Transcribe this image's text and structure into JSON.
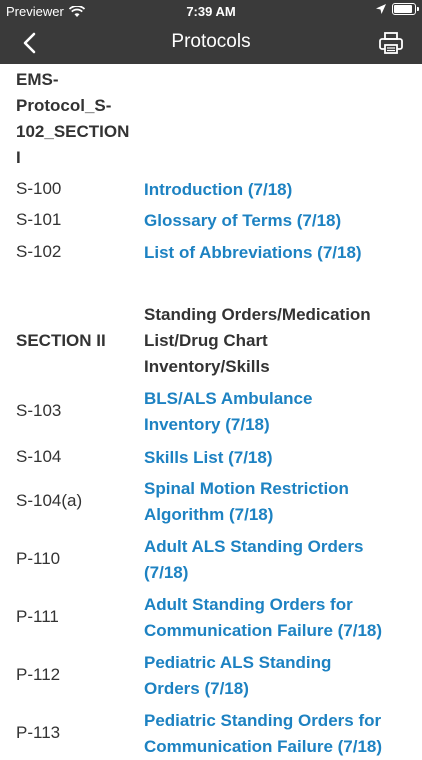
{
  "status_bar": {
    "carrier": "Previewer",
    "time": "7:39 AM"
  },
  "nav": {
    "title": "Protocols"
  },
  "protocol_title": [
    "EMS-",
    "Protocol_S-",
    "102_SECTION",
    "I"
  ],
  "section1_rows": [
    {
      "code": "S-100",
      "link": "Introduction (7/18)"
    },
    {
      "code": "S-101",
      "link": "Glossary of Terms (7/18)"
    },
    {
      "code": "S-102",
      "link": "List of Abbreviations (7/18)"
    }
  ],
  "section2": {
    "label": "SECTION II",
    "heading": [
      "Standing Orders/Medication",
      "List/Drug Chart",
      "Inventory/Skills"
    ]
  },
  "section2_rows": [
    {
      "code": "S-103",
      "link": [
        "BLS/ALS Ambulance",
        "Inventory (7/18)"
      ]
    },
    {
      "code": "S-104",
      "link": [
        "Skills List (7/18)"
      ]
    },
    {
      "code": "S-104(a)",
      "link": [
        "Spinal Motion Restriction",
        "Algorithm (7/18)"
      ]
    },
    {
      "code": "P-110",
      "link": [
        "Adult ALS Standing Orders",
        "(7/18)"
      ]
    },
    {
      "code": "P-111",
      "link": [
        "Adult Standing Orders for",
        "Communication Failure (7/18)"
      ]
    },
    {
      "code": "P-112",
      "link": [
        "Pediatric ALS Standing",
        "Orders (7/18)"
      ]
    },
    {
      "code": "P-113",
      "link": [
        "Pediatric Standing Orders for",
        "Communication Failure (7/18)"
      ]
    }
  ],
  "colors": {
    "bar": "#3a3a3a",
    "link": "#1d82c2",
    "text": "#333333"
  }
}
